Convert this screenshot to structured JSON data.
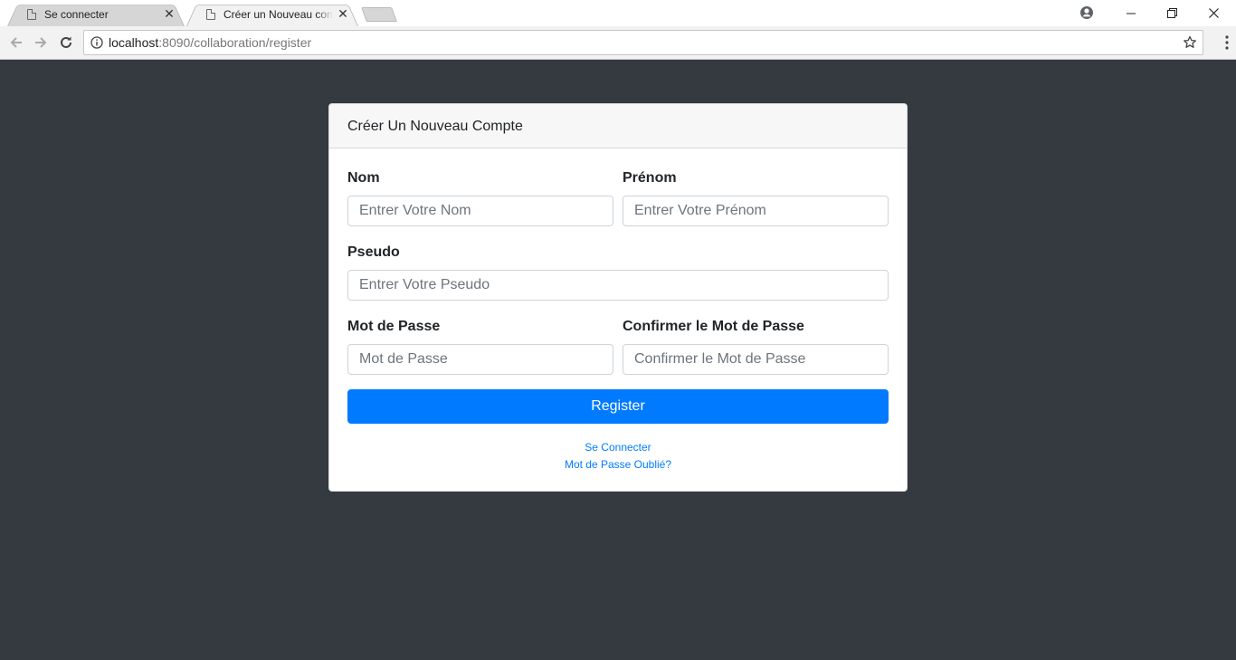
{
  "browser": {
    "tabs": [
      {
        "title": "Se connecter",
        "active": false
      },
      {
        "title": "Créer un Nouveau compte",
        "active": true
      }
    ],
    "url_host": "localhost",
    "url_rest": ":8090/collaboration/register"
  },
  "card": {
    "header": "Créer Un Nouveau Compte",
    "fields": {
      "nom": {
        "label": "Nom",
        "placeholder": "Entrer Votre Nom",
        "value": ""
      },
      "prenom": {
        "label": "Prénom",
        "placeholder": "Entrer Votre Prénom",
        "value": ""
      },
      "pseudo": {
        "label": "Pseudo",
        "placeholder": "Entrer Votre Pseudo",
        "value": ""
      },
      "password": {
        "label": "Mot de Passe",
        "placeholder": "Mot de Passe",
        "value": ""
      },
      "confirm": {
        "label": "Confirmer le Mot de Passe",
        "placeholder": "Confirmer le Mot de Passe",
        "value": ""
      }
    },
    "register_label": "Register",
    "links": {
      "login": "Se Connecter",
      "forgot": "Mot de Passe Oublié?"
    }
  },
  "colors": {
    "page_bg": "#343a40",
    "primary": "#007bff"
  }
}
